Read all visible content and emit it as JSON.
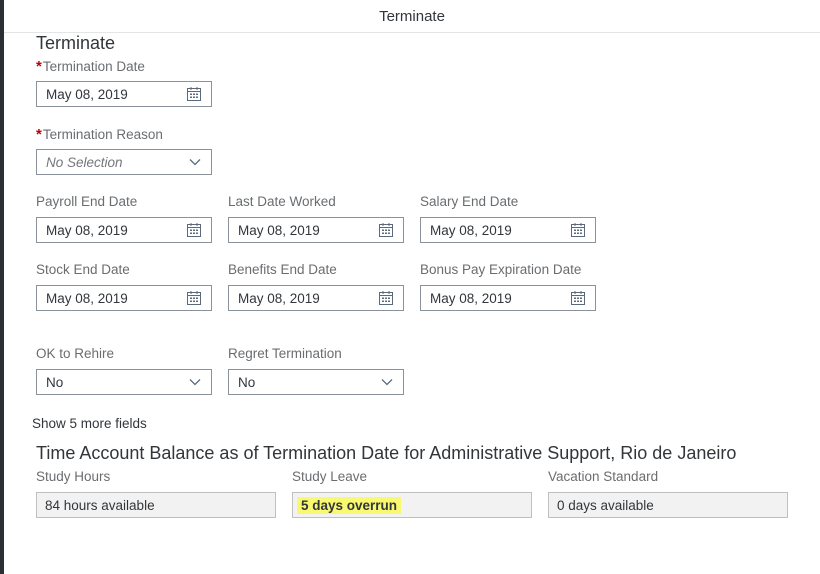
{
  "dialog": {
    "title": "Terminate"
  },
  "section": {
    "title": "Terminate"
  },
  "required_marker": "*",
  "fields": {
    "termination_date": {
      "label": "Termination Date",
      "value": "May 08, 2019"
    },
    "termination_reason": {
      "label": "Termination Reason",
      "placeholder": "No Selection"
    },
    "payroll_end_date": {
      "label": "Payroll End Date",
      "value": "May 08, 2019"
    },
    "last_date_worked": {
      "label": "Last Date Worked",
      "value": "May 08, 2019"
    },
    "salary_end_date": {
      "label": "Salary End Date",
      "value": "May 08, 2019"
    },
    "stock_end_date": {
      "label": "Stock End Date",
      "value": "May 08, 2019"
    },
    "benefits_end_date": {
      "label": "Benefits End Date",
      "value": "May 08, 2019"
    },
    "bonus_pay_expiration_date": {
      "label": "Bonus Pay Expiration Date",
      "value": "May 08, 2019"
    },
    "ok_to_rehire": {
      "label": "OK to Rehire",
      "value": "No"
    },
    "regret_termination": {
      "label": "Regret Termination",
      "value": "No"
    }
  },
  "show_more": {
    "label": "Show 5 more fields"
  },
  "balance": {
    "title": "Time Account Balance as of Termination Date for Administrative Support, Rio de Janeiro",
    "items": [
      {
        "label": "Study Hours",
        "value": "84 hours available"
      },
      {
        "label": "Study Leave",
        "value": "5 days overrun",
        "highlight_color": "#f9f871"
      },
      {
        "label": "Vacation Standard",
        "value": "0 days available"
      }
    ]
  },
  "icons": {
    "date_picker": "calendar-icon",
    "dropdown": "chevron-down-icon"
  },
  "colors": {
    "required": "#bb0000",
    "highlight": "#f9f871"
  }
}
